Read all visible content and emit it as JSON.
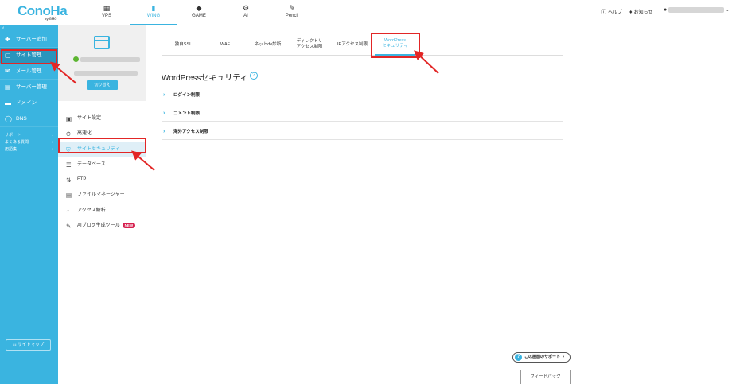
{
  "header": {
    "logo_text": "ConoHa",
    "logo_sub": "by GMO",
    "services": [
      {
        "label": "VPS",
        "icon": "server-icon"
      },
      {
        "label": "WING",
        "icon": "wing-icon"
      },
      {
        "label": "GAME",
        "icon": "gamepad-icon"
      },
      {
        "label": "AI",
        "icon": "ai-icon"
      },
      {
        "label": "Pencil",
        "icon": "pencil-icon"
      }
    ],
    "help_label": "ヘルプ",
    "notice_label": "お知らせ"
  },
  "left_nav": {
    "items": [
      {
        "label": "サーバー追加",
        "icon": "plus-icon"
      },
      {
        "label": "サイト管理",
        "icon": "site-icon"
      },
      {
        "label": "メール管理",
        "icon": "mail-icon"
      },
      {
        "label": "サーバー管理",
        "icon": "server-manage-icon"
      },
      {
        "label": "ドメイン",
        "icon": "domain-icon"
      },
      {
        "label": "DNS",
        "icon": "globe-icon"
      }
    ],
    "sub_items": [
      "サポート",
      "よくある質問",
      "用語集"
    ],
    "sitemap_label": "サイトマップ"
  },
  "site_panel": {
    "switch_label": "切り替え",
    "items": [
      {
        "label": "サイト設定",
        "icon": "site-settings-icon"
      },
      {
        "label": "高速化",
        "icon": "stopwatch-icon"
      },
      {
        "label": "サイトセキュリティ",
        "icon": "shield-icon"
      },
      {
        "label": "データベース",
        "icon": "database-icon"
      },
      {
        "label": "FTP",
        "icon": "ftp-icon"
      },
      {
        "label": "ファイルマネージャー",
        "icon": "folder-icon"
      },
      {
        "label": "アクセス解析",
        "icon": "pie-chart-icon"
      },
      {
        "label": "AIブログ生成ツール",
        "icon": "ai-blog-icon",
        "badge": "NEW"
      }
    ]
  },
  "main": {
    "tabs": [
      {
        "label": "独自SSL"
      },
      {
        "label": "WAF"
      },
      {
        "label": "ネットde診断"
      },
      {
        "label": "ディレクトリ\nアクセス制限"
      },
      {
        "label": "IPアクセス制限"
      },
      {
        "label": "WordPress\nセキュリティ"
      }
    ],
    "title": "WordPressセキュリティ",
    "accordion": [
      {
        "label": "ログイン制限"
      },
      {
        "label": "コメント制限"
      },
      {
        "label": "海外アクセス制限"
      }
    ],
    "support_label": "この画面のサポート",
    "feedback_label": "フィードバック"
  },
  "colors": {
    "accent": "#3ab4e0",
    "annotation": "#e22626",
    "badge": "#d6204f"
  }
}
